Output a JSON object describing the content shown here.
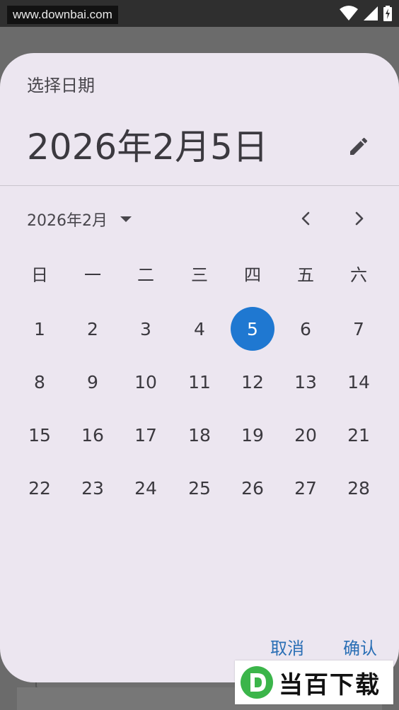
{
  "status_bar": {
    "watermark": "www.downbai.com",
    "icons": [
      "wifi-icon",
      "cellular-signal-icon",
      "battery-charging-icon"
    ]
  },
  "dialog": {
    "title": "选择日期",
    "headline": "2026年2月5日",
    "edit_icon": "pencil-icon",
    "month_label": "2026年2月",
    "month_dropdown_icon": "caret-down-icon",
    "prev_icon": "chevron-left-icon",
    "next_icon": "chevron-right-icon",
    "weekdays": [
      "日",
      "一",
      "二",
      "三",
      "四",
      "五",
      "六"
    ],
    "days": [
      [
        "1",
        "2",
        "3",
        "4",
        "5",
        "6",
        "7"
      ],
      [
        "8",
        "9",
        "10",
        "11",
        "12",
        "13",
        "14"
      ],
      [
        "15",
        "16",
        "17",
        "18",
        "19",
        "20",
        "21"
      ],
      [
        "22",
        "23",
        "24",
        "25",
        "26",
        "27",
        "28"
      ]
    ],
    "selected_day": "5",
    "cancel_label": "取消",
    "ok_label": "确认"
  },
  "colors": {
    "dialog_bg": "#ece6f0",
    "selected_bg": "#1f78d1",
    "action_text": "#2a6fb5",
    "scrim": "#6b6b6b"
  },
  "logo": {
    "text": "当百下载",
    "mark_letter": "D"
  }
}
